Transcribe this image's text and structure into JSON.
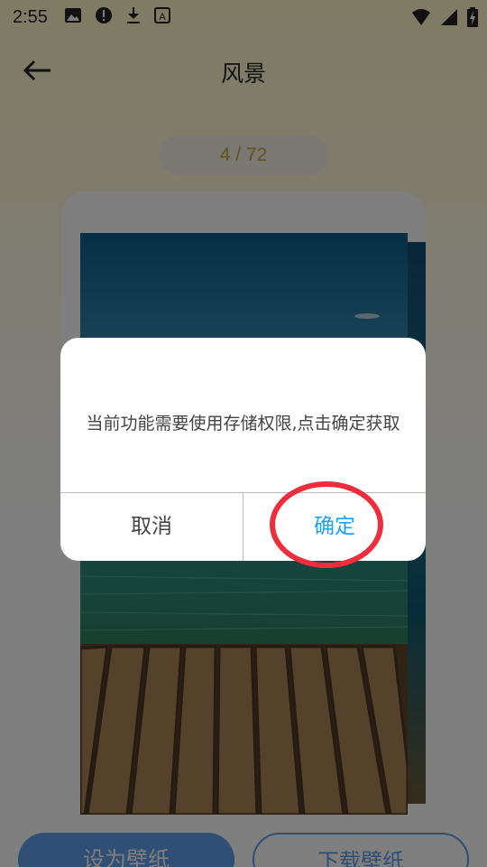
{
  "status_bar": {
    "time": "2:55",
    "icons": [
      "image-icon",
      "alert-icon",
      "download-icon",
      "font-icon"
    ],
    "right_icons": [
      "wifi-icon",
      "cell-signal-icon",
      "battery-charging-icon"
    ]
  },
  "header": {
    "back_icon": "arrow-left-icon",
    "title": "风景"
  },
  "counter": "4 / 72",
  "bottom_bar": {
    "set_wallpaper_label": "设为壁纸",
    "download_label": "下载壁纸"
  },
  "dialog": {
    "message": "当前功能需要使用存储权限,点击确定获取",
    "cancel_label": "取消",
    "confirm_label": "确定"
  },
  "colors": {
    "accent_blue": "#5f9ee8",
    "confirm_text": "#1aa3f0",
    "highlight_red": "#f02d3c",
    "counter_text": "#c5a637"
  }
}
